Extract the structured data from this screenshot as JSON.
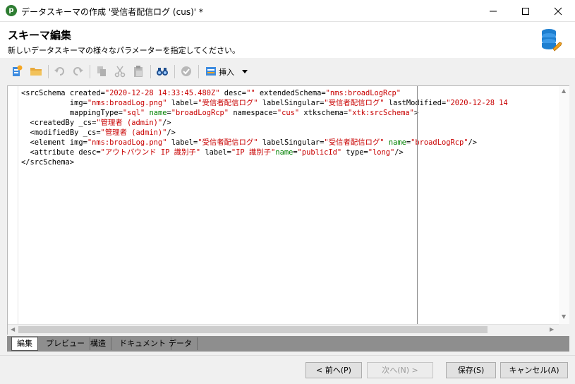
{
  "window": {
    "title": "データスキーマの作成 '受信者配信ログ (cus)' *",
    "app_icon_letter": "p"
  },
  "header": {
    "title": "スキーマ編集",
    "subtitle": "新しいデータスキーマの様々なパラメーターを指定してください。"
  },
  "toolbar": {
    "insert_label": "挿入",
    "icons": [
      "new-entity-icon",
      "open-folder-icon",
      "undo-icon",
      "redo-icon",
      "copy-icon",
      "cut-icon",
      "paste-icon",
      "find-icon",
      "validate-icon",
      "insert-icon"
    ]
  },
  "editor": {
    "lines": [
      [
        [
          "k",
          "<srcSchema created="
        ],
        [
          "v",
          "\"2020-12-28 14:33:45.480Z\""
        ],
        [
          "k",
          " desc="
        ],
        [
          "v",
          "\"\""
        ],
        [
          "k",
          " extendedSchema="
        ],
        [
          "v",
          "\"nms:broadLogRcp\""
        ]
      ],
      [
        [
          "k",
          "           img="
        ],
        [
          "v",
          "\"nms:broadLog.png\""
        ],
        [
          "k",
          " label="
        ],
        [
          "v",
          "\"受信者配信ログ\""
        ],
        [
          "k",
          " labelSingular="
        ],
        [
          "v",
          "\"受信者配信ログ\""
        ],
        [
          "k",
          " lastModified="
        ],
        [
          "v",
          "\"2020-12-28 14"
        ]
      ],
      [
        [
          "k",
          "           mappingType="
        ],
        [
          "v",
          "\"sql\""
        ],
        [
          "k",
          " "
        ],
        [
          "g",
          "name"
        ],
        [
          "k",
          "="
        ],
        [
          "v",
          "\"broadLogRcp\""
        ],
        [
          "k",
          " namespace="
        ],
        [
          "v",
          "\"cus\""
        ],
        [
          "k",
          " xtkschema="
        ],
        [
          "v",
          "\"xtk:srcSchema\""
        ],
        [
          "k",
          ">"
        ]
      ],
      [
        [
          "k",
          "  <createdBy _cs="
        ],
        [
          "v",
          "\"管理者 (admin)\""
        ],
        [
          "k",
          "/>"
        ]
      ],
      [
        [
          "k",
          "  <modifiedBy _cs="
        ],
        [
          "v",
          "\"管理者 (admin)\""
        ],
        [
          "k",
          "/>"
        ]
      ],
      [
        [
          "k",
          "  <element img="
        ],
        [
          "v",
          "\"nms:broadLog.png\""
        ],
        [
          "k",
          " label="
        ],
        [
          "v",
          "\"受信者配信ログ\""
        ],
        [
          "k",
          " labelSingular="
        ],
        [
          "v",
          "\"受信者配信ログ\""
        ],
        [
          "k",
          " "
        ],
        [
          "g",
          "name"
        ],
        [
          "k",
          "="
        ],
        [
          "v",
          "\"broadLogRcp\""
        ],
        [
          "k",
          "/>"
        ]
      ],
      [
        [
          "k",
          "  <attribute desc="
        ],
        [
          "v",
          "\"アウトバウンド IP 識別子\""
        ],
        [
          "k",
          " label="
        ],
        [
          "v",
          "\"IP 識別子\""
        ],
        [
          "g",
          "name"
        ],
        [
          "k",
          "="
        ],
        [
          "v",
          "\"publicId\""
        ],
        [
          "k",
          " type="
        ],
        [
          "v",
          "\"long\""
        ],
        [
          "k",
          "/>"
        ]
      ],
      [
        [
          "k",
          "</srcSchema>"
        ]
      ]
    ]
  },
  "tabs": [
    {
      "label": "編集",
      "active": true
    },
    {
      "label": "プレビュー",
      "active": false
    },
    {
      "label": "構造",
      "active": false
    },
    {
      "label": "ドキュメント",
      "active": false
    },
    {
      "label": "データ",
      "active": false
    }
  ],
  "footer": {
    "prev_label": "< 前へ(P)",
    "next_label": "次へ(N) >",
    "save_label": "保存(S)",
    "cancel_label": "キャンセル(A)"
  },
  "colors": {
    "tag": "#000000",
    "value": "#c80000",
    "name_attr": "#008000"
  }
}
